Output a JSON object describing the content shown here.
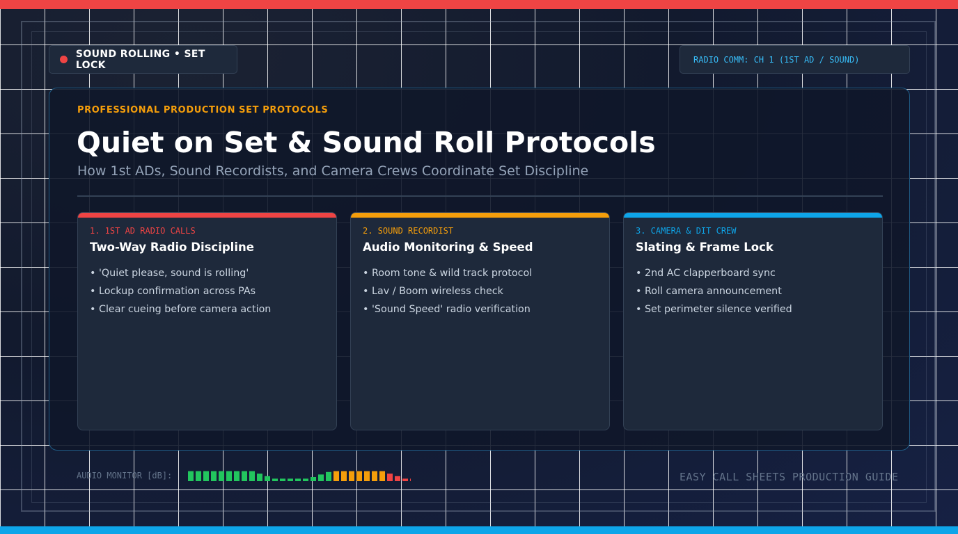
{
  "colors": {
    "red": "#ef4444",
    "amber": "#f59e0b",
    "sky": "#0ea5e9",
    "green": "#22c55e",
    "sky_light": "#38bdf8"
  },
  "status": {
    "icon": "recording-dot-icon",
    "label": "SOUND ROLLING • SET LOCK"
  },
  "radio": {
    "label": "RADIO COMM: CH 1 (1ST AD / SOUND)"
  },
  "header": {
    "eyebrow": "PROFESSIONAL PRODUCTION SET PROTOCOLS",
    "title": "Quiet on Set & Sound Roll Protocols",
    "subtitle": "How 1st ADs, Sound Recordists, and Camera Crews Coordinate Set Discipline"
  },
  "cards": [
    {
      "tag": "1. 1ST AD RADIO CALLS",
      "title": "Two-Way Radio Discipline",
      "accent": "#ef4444",
      "items": [
        "• 'Quiet please, sound is rolling'",
        "• Lockup confirmation across PAs",
        "• Clear cueing before camera action"
      ]
    },
    {
      "tag": "2. SOUND RECORDIST",
      "title": "Audio Monitoring & Speed",
      "accent": "#f59e0b",
      "items": [
        "• Room tone & wild track protocol",
        "• Lav / Boom wireless check",
        "• 'Sound Speed' radio verification"
      ]
    },
    {
      "tag": "3. CAMERA & DIT CREW",
      "title": "Slating & Frame Lock",
      "accent": "#0ea5e9",
      "items": [
        "• 2nd AC clapperboard sync",
        "• Roll camera announcement",
        "• Set perimeter silence verified"
      ]
    }
  ],
  "audio_monitor": {
    "label": "AUDIO MONITOR [dB]:",
    "levels": [
      0.6,
      0.6,
      0.6,
      0.6,
      0.6,
      0.6,
      0.6,
      0.6,
      0.6,
      0.45,
      0.3,
      0.15,
      0.15,
      0.15,
      0.15,
      0.15,
      0.25,
      0.4,
      0.55,
      0.6,
      0.6,
      0.6,
      0.6,
      0.6,
      0.6,
      0.6,
      0.45,
      0.3,
      0.15,
      0.15
    ],
    "zones": [
      "green",
      "green",
      "green",
      "green",
      "green",
      "green",
      "green",
      "green",
      "green",
      "green",
      "green",
      "green",
      "green",
      "green",
      "green",
      "green",
      "green",
      "green",
      "green",
      "amber",
      "amber",
      "amber",
      "amber",
      "amber",
      "amber",
      "amber",
      "red",
      "red",
      "red",
      "red"
    ]
  },
  "footer": {
    "brand": "EASY CALL SHEETS PRODUCTION GUIDE"
  }
}
